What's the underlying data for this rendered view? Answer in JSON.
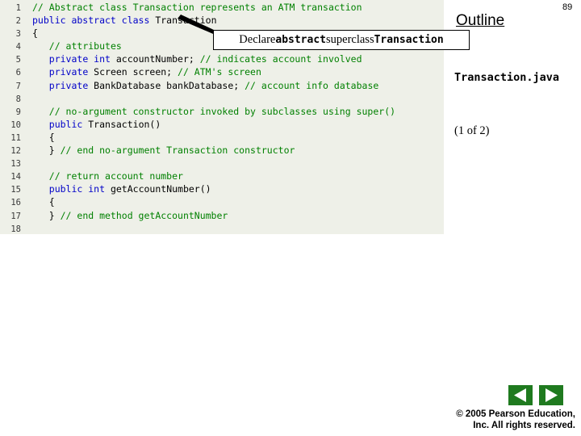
{
  "slide": {
    "number": "89",
    "outline_label": "Outline",
    "filename": "Transaction.java",
    "page_of": "(1 of 2)"
  },
  "callout": {
    "prefix": "Declare ",
    "mono1": "abstract",
    "middle": " superclass ",
    "mono2": "Transaction"
  },
  "code": {
    "lines": [
      {
        "n": "1",
        "segments": [
          {
            "t": "// Abstract class Transaction represents an ATM transaction",
            "c": "cm"
          }
        ]
      },
      {
        "n": "2",
        "segments": [
          {
            "t": "public abstract class",
            "c": "kw"
          },
          {
            "t": " Transaction",
            "c": "pl"
          }
        ]
      },
      {
        "n": "3",
        "segments": [
          {
            "t": "{",
            "c": "pl"
          }
        ]
      },
      {
        "n": "4",
        "segments": [
          {
            "t": "   ",
            "c": "pl"
          },
          {
            "t": "// attributes",
            "c": "cm"
          }
        ]
      },
      {
        "n": "5",
        "segments": [
          {
            "t": "   ",
            "c": "pl"
          },
          {
            "t": "private int",
            "c": "kw"
          },
          {
            "t": " accountNumber; ",
            "c": "pl"
          },
          {
            "t": "// indicates account involved",
            "c": "cm"
          }
        ]
      },
      {
        "n": "6",
        "segments": [
          {
            "t": "   ",
            "c": "pl"
          },
          {
            "t": "private",
            "c": "kw"
          },
          {
            "t": " Screen screen; ",
            "c": "pl"
          },
          {
            "t": "// ATM's screen",
            "c": "cm"
          }
        ]
      },
      {
        "n": "7",
        "segments": [
          {
            "t": "   ",
            "c": "pl"
          },
          {
            "t": "private",
            "c": "kw"
          },
          {
            "t": " BankDatabase bankDatabase; ",
            "c": "pl"
          },
          {
            "t": "// account info database",
            "c": "cm"
          }
        ]
      },
      {
        "n": "8",
        "segments": [
          {
            "t": "",
            "c": "pl"
          }
        ]
      },
      {
        "n": "9",
        "segments": [
          {
            "t": "   ",
            "c": "pl"
          },
          {
            "t": "// no-argument constructor invoked by subclasses using super()",
            "c": "cm"
          }
        ]
      },
      {
        "n": "10",
        "segments": [
          {
            "t": "   ",
            "c": "pl"
          },
          {
            "t": "public",
            "c": "kw"
          },
          {
            "t": " Transaction()",
            "c": "pl"
          }
        ]
      },
      {
        "n": "11",
        "segments": [
          {
            "t": "   {",
            "c": "pl"
          }
        ]
      },
      {
        "n": "12",
        "segments": [
          {
            "t": "   } ",
            "c": "pl"
          },
          {
            "t": "// end no-argument Transaction constructor",
            "c": "cm"
          }
        ]
      },
      {
        "n": "13",
        "segments": [
          {
            "t": "",
            "c": "pl"
          }
        ]
      },
      {
        "n": "14",
        "segments": [
          {
            "t": "   ",
            "c": "pl"
          },
          {
            "t": "// return account number",
            "c": "cm"
          }
        ]
      },
      {
        "n": "15",
        "segments": [
          {
            "t": "   ",
            "c": "pl"
          },
          {
            "t": "public int",
            "c": "kw"
          },
          {
            "t": " getAccountNumber()",
            "c": "pl"
          }
        ]
      },
      {
        "n": "16",
        "segments": [
          {
            "t": "   {",
            "c": "pl"
          }
        ]
      },
      {
        "n": "17",
        "segments": [
          {
            "t": "   } ",
            "c": "pl"
          },
          {
            "t": "// end method getAccountNumber",
            "c": "cm"
          }
        ]
      },
      {
        "n": "18",
        "segments": [
          {
            "t": "",
            "c": "pl"
          }
        ]
      }
    ]
  },
  "nav": {
    "prev_label": "previous-slide",
    "next_label": "next-slide",
    "color": "#1f7a1f"
  },
  "footer": {
    "line1": "© 2005 Pearson Education,",
    "line2": "Inc.  All rights reserved."
  }
}
